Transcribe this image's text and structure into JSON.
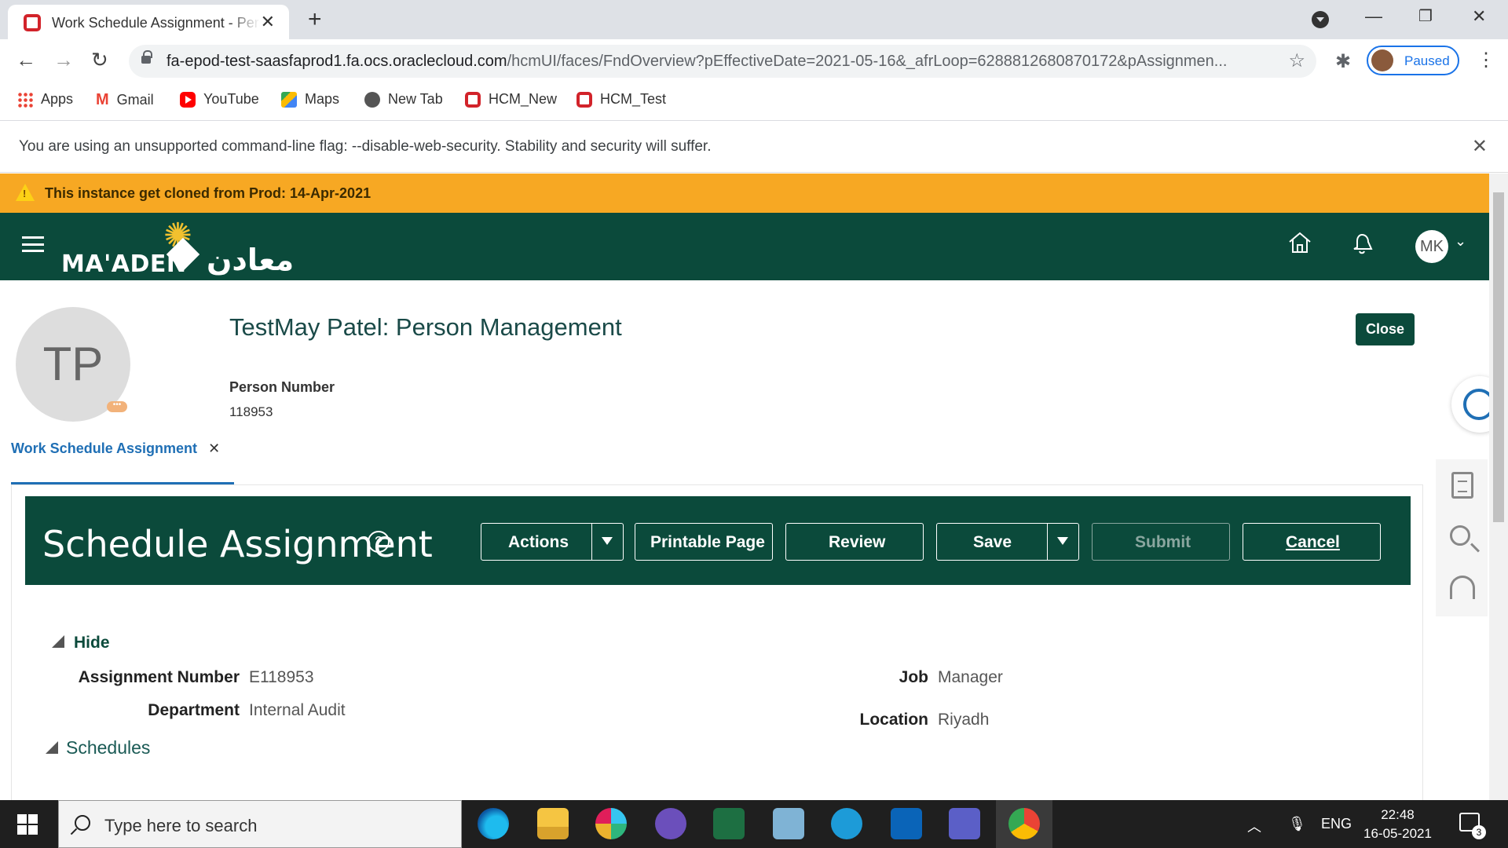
{
  "browser": {
    "tab_title": "Work Schedule Assignment - Person Management",
    "url_host": "fa-epod-test-saasfaprod1.fa.ocs.oraclecloud.com",
    "url_path": "/hcmUI/faces/FndOverview?pEffectiveDate=2021-05-16&_afrLoop=6288812680870172&pAssignmen...",
    "profile_status": "Paused",
    "bookmarks": [
      "Apps",
      "Gmail",
      "YouTube",
      "Maps",
      "New Tab",
      "HCM_New",
      "HCM_Test"
    ],
    "infobar_message": "You are using an unsupported command-line flag: --disable-web-security. Stability and security will suffer."
  },
  "app": {
    "warning": "This instance get cloned from Prod: 14-Apr-2021",
    "logo_en": "MA'ADEN",
    "logo_ar": "معادن",
    "user_initials": "MK",
    "person": {
      "initials": "TP",
      "title": "TestMay Patel: Person Management",
      "number_label": "Person Number",
      "number_value": "118953"
    },
    "close_label": "Close",
    "subtab_label": "Work Schedule Assignment",
    "header": {
      "title": "Schedule Assignment",
      "actions": "Actions",
      "printable": "Printable Page",
      "review": "Review",
      "save": "Save",
      "submit": "Submit",
      "cancel": "Cancel"
    },
    "hide_label": "Hide",
    "fields": {
      "assignment_number_label": "Assignment Number",
      "assignment_number_value": "E118953",
      "department_label": "Department",
      "department_value": "Internal Audit",
      "job_label": "Job",
      "job_value": "Manager",
      "location_label": "Location",
      "location_value": "Riyadh"
    },
    "schedules_label": "Schedules"
  },
  "taskbar": {
    "search_placeholder": "Type here to search",
    "language": "ENG",
    "time": "22:48",
    "date": "16-05-2021",
    "notification_count": "3"
  },
  "colors": {
    "brand_green": "#0b4a3b",
    "warning_orange": "#f7a823",
    "link_blue": "#1f6fb5"
  }
}
